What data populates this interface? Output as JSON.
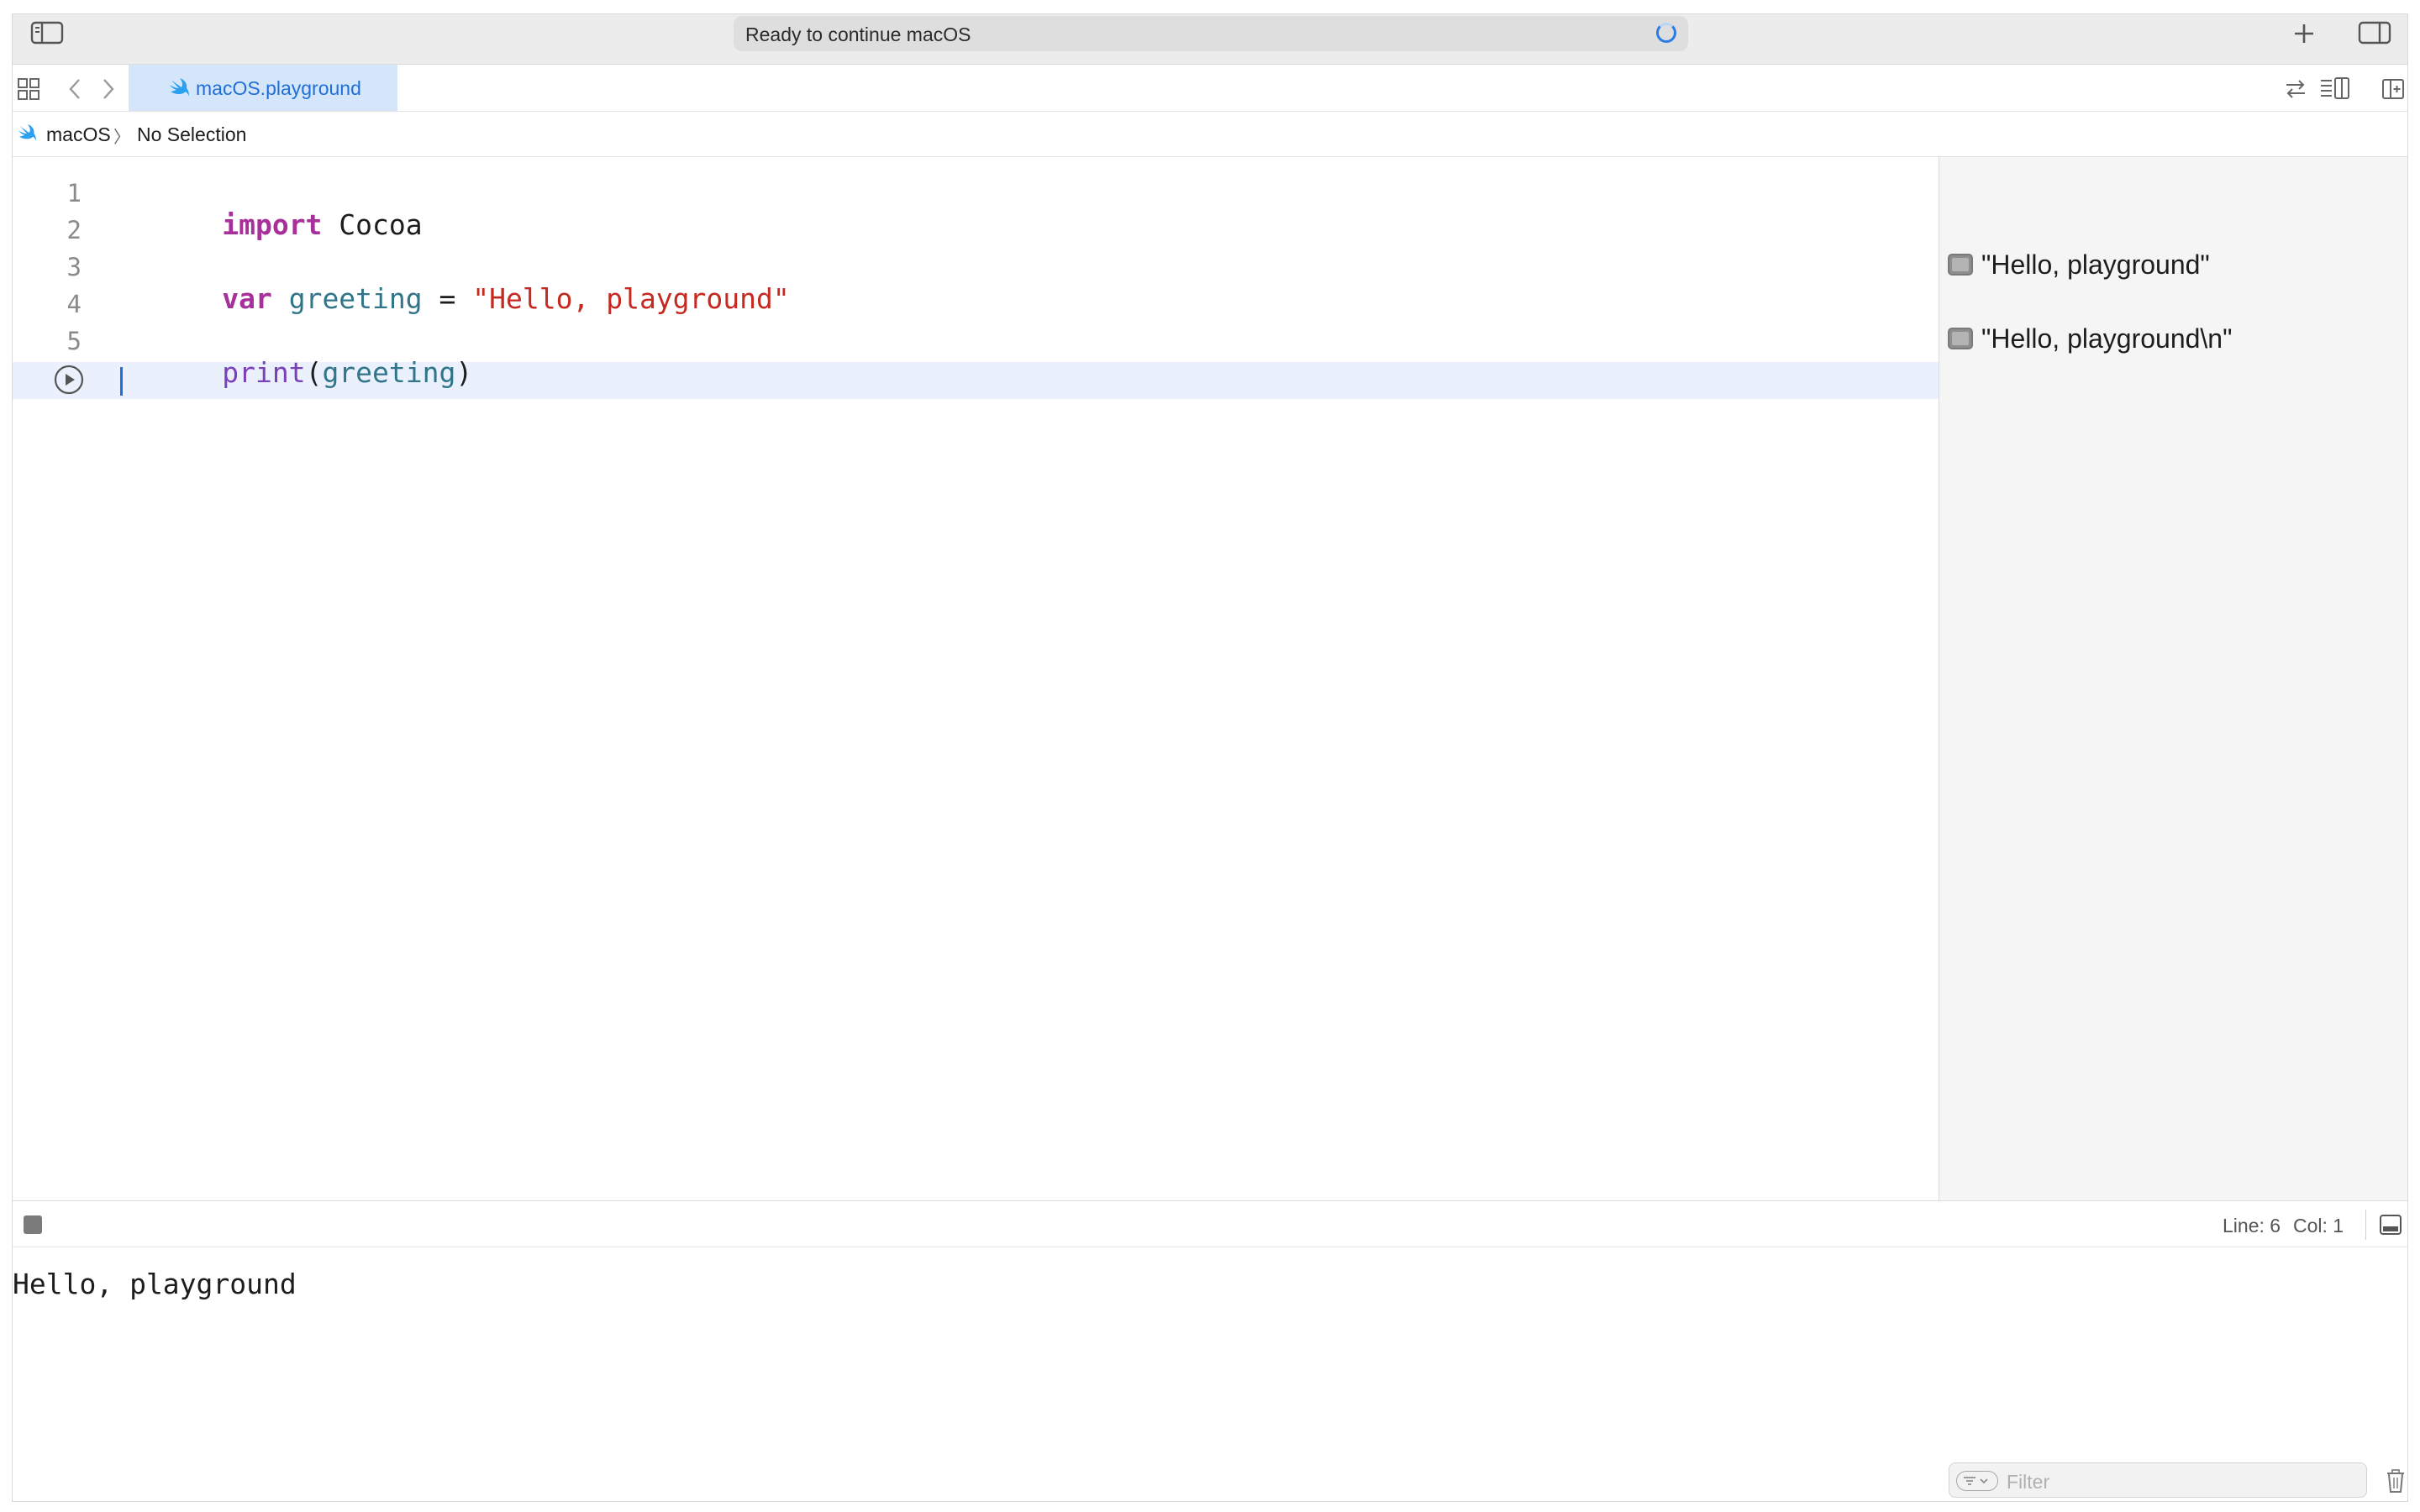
{
  "titlebar": {
    "activity_text": "Ready to continue macOS"
  },
  "tabs": [
    {
      "label": "macOS.playground",
      "active": true,
      "icon": "swift-icon"
    }
  ],
  "jumpbar": {
    "project": "macOS",
    "separator": "〉",
    "selection": "No Selection"
  },
  "editor": {
    "line_numbers": [
      "1",
      "2",
      "3",
      "4",
      "5"
    ],
    "lines": {
      "l1_kw": "import",
      "l1_rest": " Cocoa",
      "l3_kw": "var",
      "l3_var": "greeting",
      "l3_eq": " = ",
      "l3_str": "\"Hello, playground\"",
      "l5_fn": "print",
      "l5_open": "(",
      "l5_var": "greeting",
      "l5_close": ")"
    },
    "current_line": 6
  },
  "results": [
    {
      "text": "\"Hello, playground\"",
      "line": 3
    },
    {
      "text": "\"Hello, playground\\n\"",
      "line": 5
    }
  ],
  "statusbar": {
    "line_label": "Line: 6",
    "col_label": "Col: 1"
  },
  "console": {
    "output": "Hello, playground",
    "filter_placeholder": "Filter"
  },
  "colors": {
    "accent": "#1f6fd8",
    "keyword": "#a8309a",
    "string": "#c6291f",
    "variable": "#31758a",
    "function": "#7b3fb8"
  }
}
